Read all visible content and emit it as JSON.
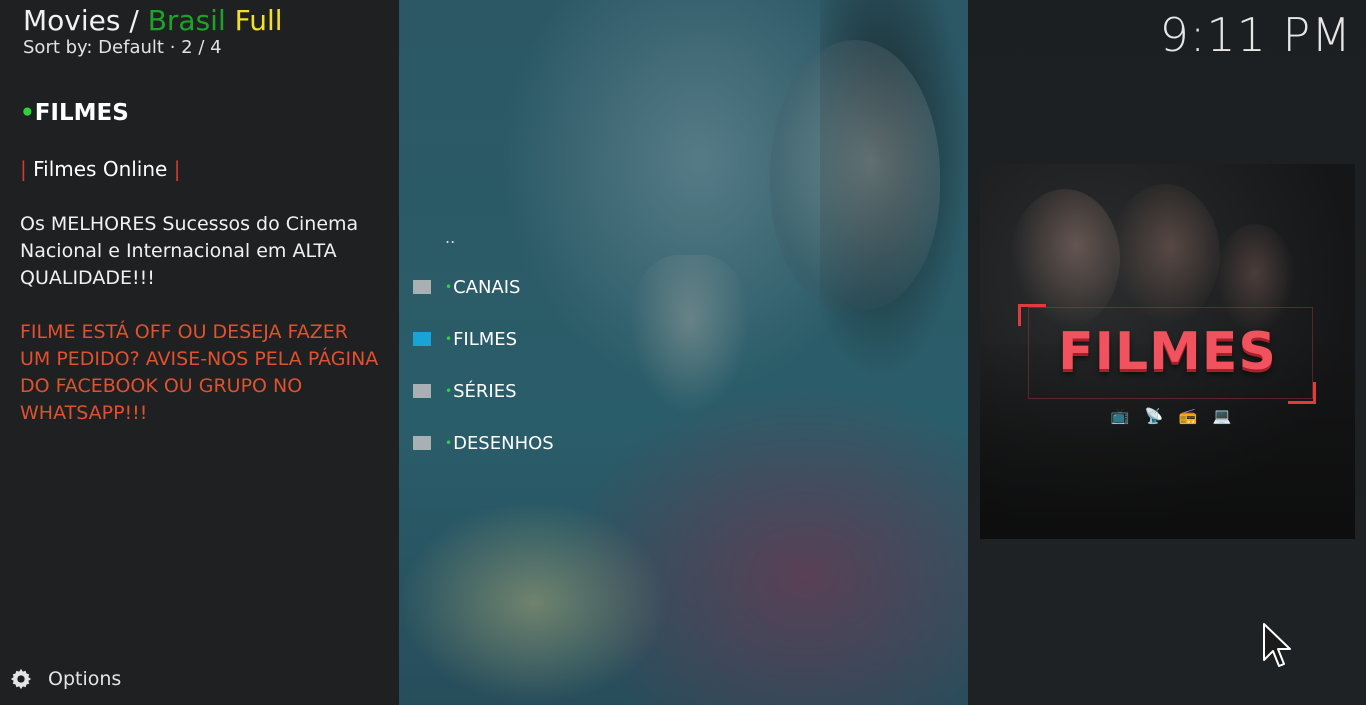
{
  "header": {
    "section": "Movies /",
    "addon_part1": "Brasil",
    "addon_part2": "Full",
    "sort_label": "Sort by: Default",
    "separator": "·",
    "position": "2 / 4",
    "clock": "9:11 PM"
  },
  "info": {
    "dot": "•",
    "title": "FILMES",
    "bar_left": "|",
    "subtitle": "Filmes Online",
    "bar_right": "|",
    "description": "Os MELHORES Sucessos do Cinema Nacional e Internacional em ALTA QUALIDADE!!!",
    "warning": "FILME ESTÁ OFF OU DESEJA FAZER UM PEDIDO? AVISE-NOS PELA PÁGINA DO FACEBOOK OU GRUPO NO WHATSAPP!!!"
  },
  "list": {
    "parent_label": "..",
    "bullet": "•",
    "items": [
      {
        "label": "CANAIS",
        "icon": "folder-icon",
        "selected": false
      },
      {
        "label": "FILMES",
        "icon": "folder-icon",
        "selected": true
      },
      {
        "label": "SÉRIES",
        "icon": "folder-icon",
        "selected": false
      },
      {
        "label": "DESENHOS",
        "icon": "folder-icon",
        "selected": false
      }
    ]
  },
  "poster": {
    "title": "FILMES",
    "icons": [
      "tv-icon",
      "satellite-icon",
      "radio-icon",
      "laptop-icon"
    ],
    "icon_glyphs": [
      "📺",
      "📡",
      "📻",
      "💻"
    ]
  },
  "footer": {
    "options_label": "Options",
    "options_icon": "gear-icon"
  },
  "colors": {
    "brasil_green": "#1ea32a",
    "full_yellow": "#f2e02a",
    "bullet_green": "#2fd13a",
    "warning_orange": "#e0512f",
    "selected_folder": "#1aa3d6",
    "poster_red": "#f0535e"
  }
}
